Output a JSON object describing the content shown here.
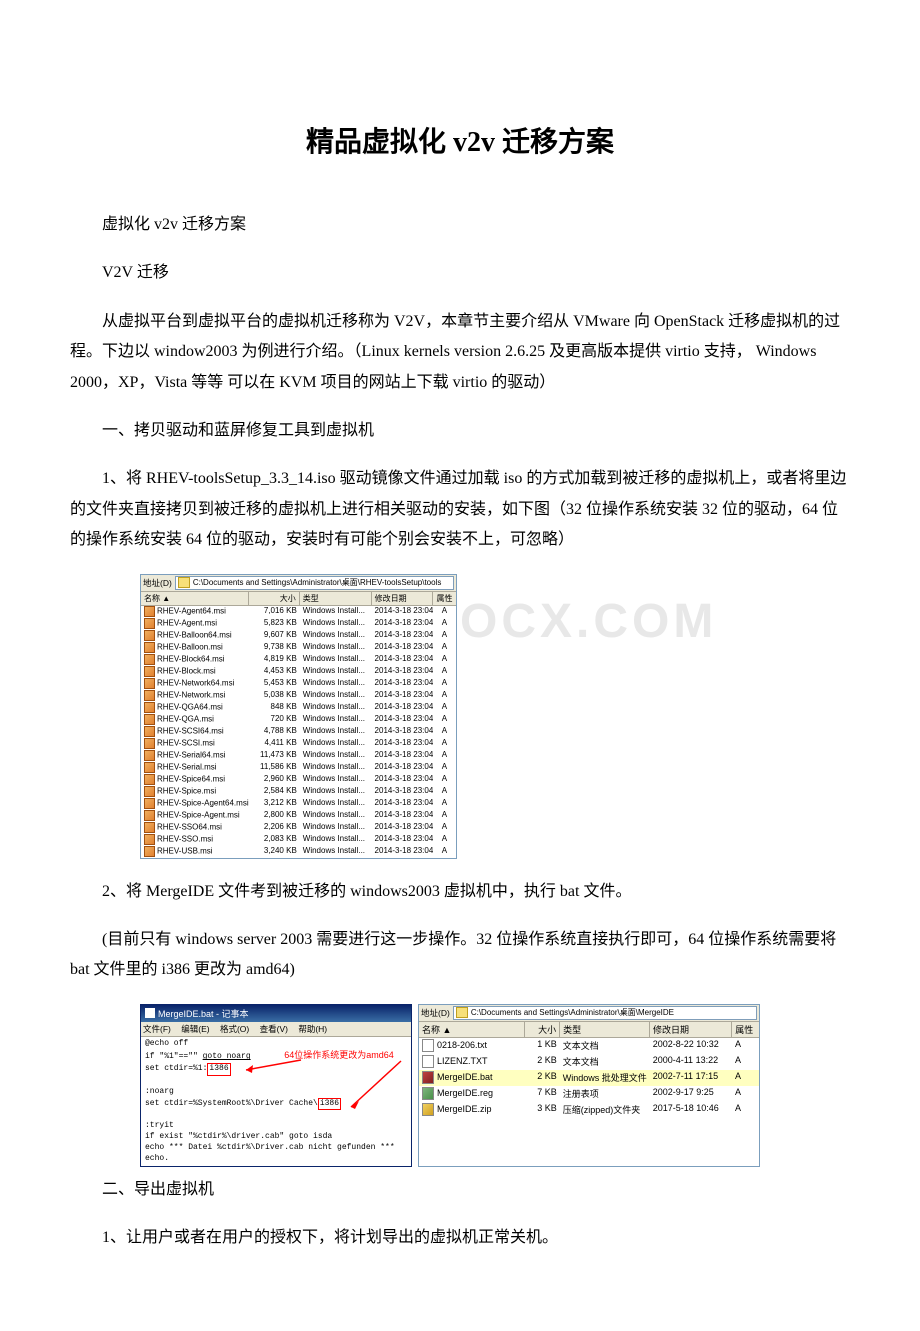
{
  "title": "精品虚拟化 v2v 迁移方案",
  "paragraphs": {
    "p1": "虚拟化 v2v 迁移方案",
    "p2": "V2V 迁移",
    "p3": "从虚拟平台到虚拟平台的虚拟机迁移称为 V2V，本章节主要介绍从 VMware 向 OpenStack 迁移虚拟机的过程。下边以 window2003 为例进行介绍。（Linux kernels version 2.6.25 及更高版本提供 virtio 支持， Windows 2000，XP，Vista 等等 可以在 KVM 项目的网站上下载 virtio 的驱动）",
    "p4": "一、拷贝驱动和蓝屏修复工具到虚拟机",
    "p5": "1、将 RHEV-toolsSetup_3.3_14.iso 驱动镜像文件通过加载 iso 的方式加载到被迁移的虚拟机上，或者将里边的文件夹直接拷贝到被迁移的虚拟机上进行相关驱动的安装，如下图（32 位操作系统安装 32 位的驱动，64 位的操作系统安装 64 位的驱动，安装时有可能个别会安装不上，可忽略）",
    "p6": "2、将 MergeIDE 文件考到被迁移的 windows2003 虚拟机中，执行 bat 文件。",
    "p7": "(目前只有 windows server 2003 需要进行这一步操作。32 位操作系统直接执行即可，64 位操作系统需要将 bat 文件里的 i386 更改为 amd64)",
    "p8": "二、导出虚拟机",
    "p9": "1、让用户或者在用户的授权下，将计划导出的虚拟机正常关机。"
  },
  "watermark": "OCX.COM",
  "explorer1": {
    "addr_label": "地址(D)",
    "addr_path": "C:\\Documents and Settings\\Administrator\\桌面\\RHEV-toolsSetup\\tools",
    "cols": {
      "name": "名称 ▲",
      "size": "大小",
      "type": "类型",
      "date": "修改日期",
      "attr": "属性"
    },
    "rows": [
      {
        "name": "RHEV-Agent64.msi",
        "size": "7,016 KB",
        "type": "Windows Install...",
        "date": "2014-3-18 23:04",
        "attr": "A"
      },
      {
        "name": "RHEV-Agent.msi",
        "size": "5,823 KB",
        "type": "Windows Install...",
        "date": "2014-3-18 23:04",
        "attr": "A"
      },
      {
        "name": "RHEV-Balloon64.msi",
        "size": "9,607 KB",
        "type": "Windows Install...",
        "date": "2014-3-18 23:04",
        "attr": "A"
      },
      {
        "name": "RHEV-Balloon.msi",
        "size": "9,738 KB",
        "type": "Windows Install...",
        "date": "2014-3-18 23:04",
        "attr": "A"
      },
      {
        "name": "RHEV-Block64.msi",
        "size": "4,819 KB",
        "type": "Windows Install...",
        "date": "2014-3-18 23:04",
        "attr": "A"
      },
      {
        "name": "RHEV-Block.msi",
        "size": "4,453 KB",
        "type": "Windows Install...",
        "date": "2014-3-18 23:04",
        "attr": "A"
      },
      {
        "name": "RHEV-Network64.msi",
        "size": "5,453 KB",
        "type": "Windows Install...",
        "date": "2014-3-18 23:04",
        "attr": "A"
      },
      {
        "name": "RHEV-Network.msi",
        "size": "5,038 KB",
        "type": "Windows Install...",
        "date": "2014-3-18 23:04",
        "attr": "A"
      },
      {
        "name": "RHEV-QGA64.msi",
        "size": "848 KB",
        "type": "Windows Install...",
        "date": "2014-3-18 23:04",
        "attr": "A"
      },
      {
        "name": "RHEV-QGA.msi",
        "size": "720 KB",
        "type": "Windows Install...",
        "date": "2014-3-18 23:04",
        "attr": "A"
      },
      {
        "name": "RHEV-SCSI64.msi",
        "size": "4,788 KB",
        "type": "Windows Install...",
        "date": "2014-3-18 23:04",
        "attr": "A"
      },
      {
        "name": "RHEV-SCSI.msi",
        "size": "4,411 KB",
        "type": "Windows Install...",
        "date": "2014-3-18 23:04",
        "attr": "A"
      },
      {
        "name": "RHEV-Serial64.msi",
        "size": "11,473 KB",
        "type": "Windows Install...",
        "date": "2014-3-18 23:04",
        "attr": "A"
      },
      {
        "name": "RHEV-Serial.msi",
        "size": "11,586 KB",
        "type": "Windows Install...",
        "date": "2014-3-18 23:04",
        "attr": "A"
      },
      {
        "name": "RHEV-Spice64.msi",
        "size": "2,960 KB",
        "type": "Windows Install...",
        "date": "2014-3-18 23:04",
        "attr": "A"
      },
      {
        "name": "RHEV-Spice.msi",
        "size": "2,584 KB",
        "type": "Windows Install...",
        "date": "2014-3-18 23:04",
        "attr": "A"
      },
      {
        "name": "RHEV-Spice-Agent64.msi",
        "size": "3,212 KB",
        "type": "Windows Install...",
        "date": "2014-3-18 23:04",
        "attr": "A"
      },
      {
        "name": "RHEV-Spice-Agent.msi",
        "size": "2,800 KB",
        "type": "Windows Install...",
        "date": "2014-3-18 23:04",
        "attr": "A"
      },
      {
        "name": "RHEV-SSO64.msi",
        "size": "2,206 KB",
        "type": "Windows Install...",
        "date": "2014-3-18 23:04",
        "attr": "A"
      },
      {
        "name": "RHEV-SSO.msi",
        "size": "2,083 KB",
        "type": "Windows Install...",
        "date": "2014-3-18 23:04",
        "attr": "A"
      },
      {
        "name": "RHEV-USB.msi",
        "size": "3,240 KB",
        "type": "Windows Install...",
        "date": "2014-3-18 23:04",
        "attr": "A"
      }
    ]
  },
  "notepad": {
    "title": "MergeIDE.bat - 记事本",
    "menu": {
      "file": "文件(F)",
      "edit": "编辑(E)",
      "format": "格式(O)",
      "view": "查看(V)",
      "help": "帮助(H)"
    },
    "lines": {
      "l1": "@echo off",
      "l2a": "if \"%1\"==\"\" ",
      "l2b": "goto noarg",
      "l3a": "set ctdir=%1:",
      "l3b": "i386",
      "l4": "",
      "l5": ":noarg",
      "l6a": "set ctdir=%SystemRoot%\\Driver Cache\\",
      "l6b": "i386",
      "l7": "",
      "l8": ":tryit",
      "l9": "if exist \"%ctdir%\\driver.cab\" goto isda",
      "l10": "echo *** Datei %ctdir%\\Driver.cab nicht gefunden ***",
      "l11": "echo."
    },
    "annotation": "64位操作系统更改为amd64"
  },
  "explorer2": {
    "addr_label": "地址(D)",
    "addr_path": "C:\\Documents and Settings\\Administrator\\桌面\\MergeIDE",
    "cols": {
      "name": "名称 ▲",
      "size": "大小",
      "type": "类型",
      "date": "修改日期",
      "attr": "属性"
    },
    "rows": [
      {
        "ico": "txt-ico",
        "name": "0218-206.txt",
        "size": "1 KB",
        "type": "文本文档",
        "date": "2002-8-22 10:32",
        "attr": "A"
      },
      {
        "ico": "txt-ico",
        "name": "LIZENZ.TXT",
        "size": "2 KB",
        "type": "文本文档",
        "date": "2000-4-11 13:22",
        "attr": "A"
      },
      {
        "ico": "sel-ico",
        "name": "MergeIDE.bat",
        "size": "2 KB",
        "type": "Windows 批处理文件",
        "date": "2002-7-11 17:15",
        "attr": "A",
        "sel": true
      },
      {
        "ico": "reg-ico",
        "name": "MergeIDE.reg",
        "size": "7 KB",
        "type": "注册表项",
        "date": "2002-9-17 9:25",
        "attr": "A"
      },
      {
        "ico": "zip-ico",
        "name": "MergeIDE.zip",
        "size": "3 KB",
        "type": "压缩(zipped)文件夹",
        "date": "2017-5-18 10:46",
        "attr": "A"
      }
    ]
  }
}
